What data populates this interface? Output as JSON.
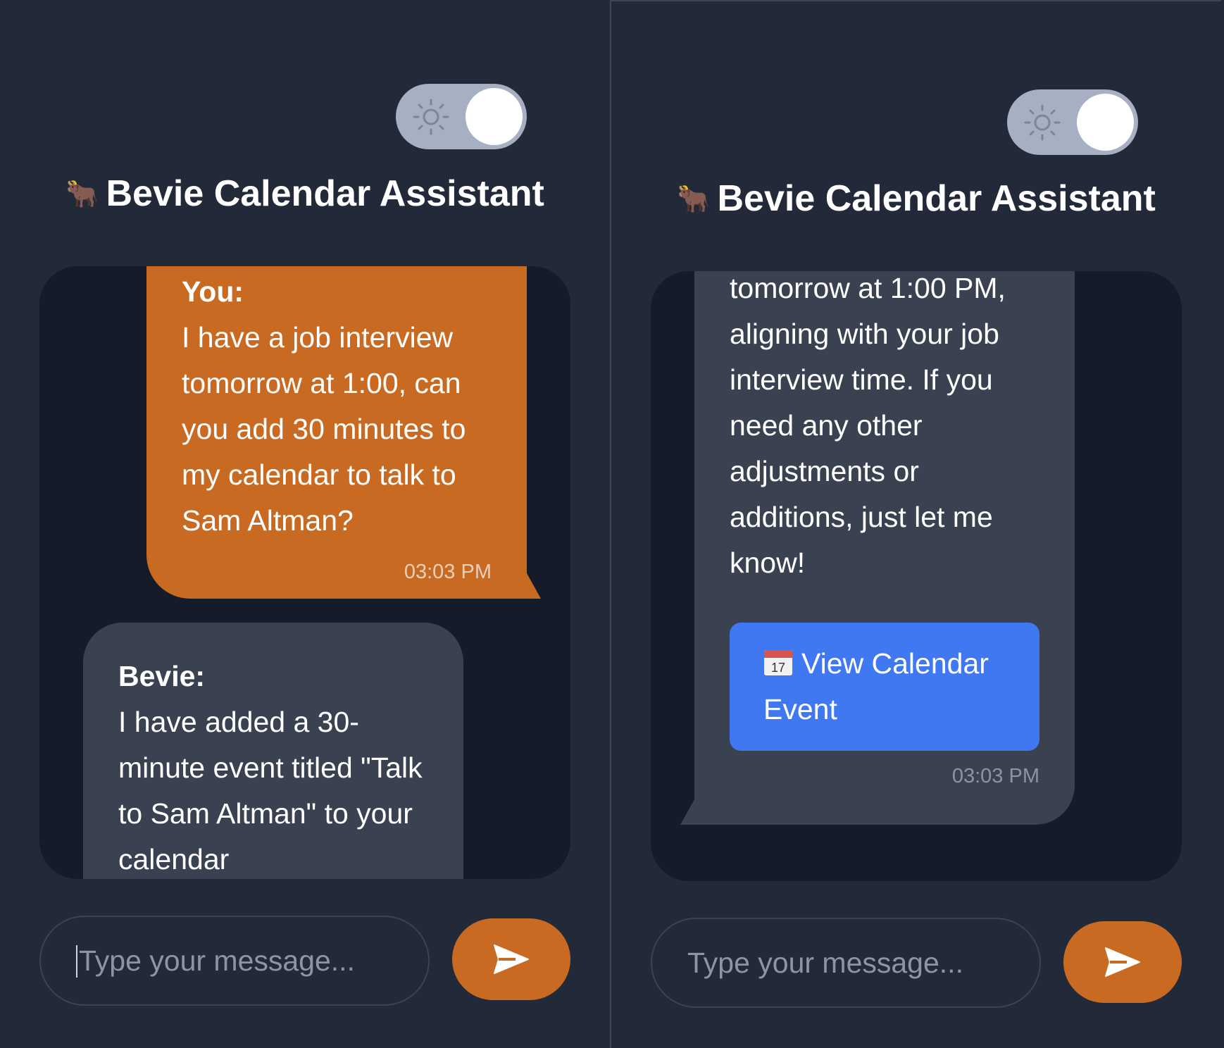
{
  "app": {
    "title": "Bevie Calendar Assistant",
    "title_emoji": "🐂",
    "theme_toggle_icon": "sun-icon",
    "accent_color": "#c96a23",
    "link_button_color": "#4078f2"
  },
  "left_panel": {
    "user_message": {
      "sender": "You:",
      "text": "I have a job interview tomorrow at 1:00, can you add 30 minutes to my calendar to talk to Sam Altman?",
      "time": "03:03 PM"
    },
    "bot_message": {
      "sender": "Bevie:",
      "text": "I have added a 30-minute event titled \"Talk to Sam Altman\" to your calendar"
    },
    "input": {
      "placeholder": "Type your message..."
    }
  },
  "right_panel": {
    "bot_message": {
      "text": "tomorrow at 1:00 PM, aligning with your job interview time. If you need any other adjustments or additions, just let me know!",
      "button_label": "View Calendar Event",
      "button_icon": "calendar-icon",
      "time": "03:03 PM"
    },
    "input": {
      "placeholder": "Type your message..."
    }
  }
}
